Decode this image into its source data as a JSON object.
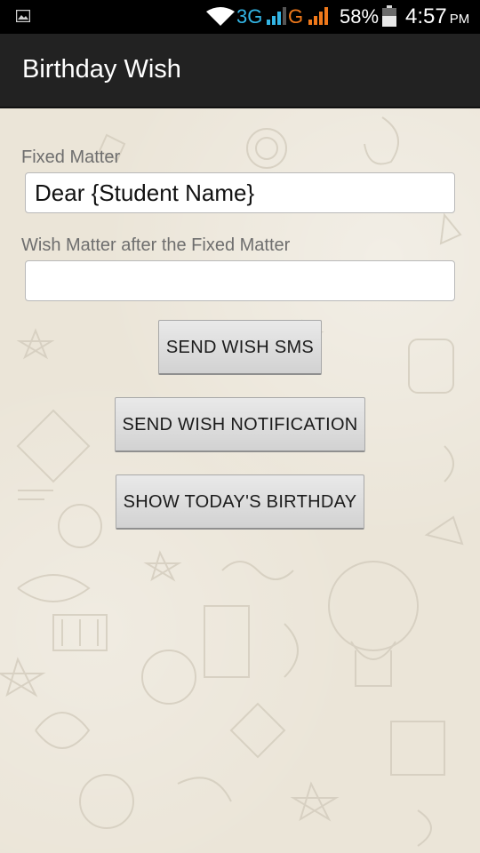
{
  "status_bar": {
    "network_3g": "3G",
    "network_g": "G",
    "battery_percent": "58%",
    "time": "4:57",
    "ampm": "PM"
  },
  "action_bar": {
    "title": "Birthday Wish"
  },
  "form": {
    "fixed_matter_label": "Fixed Matter",
    "fixed_matter_value": "Dear {Student Name}",
    "wish_matter_label": "Wish Matter after the Fixed Matter",
    "wish_matter_value": ""
  },
  "buttons": {
    "send_sms": "SEND WISH SMS",
    "send_notification": "SEND WISH NOTIFICATION",
    "show_birthday": "SHOW TODAY'S BIRTHDAY"
  },
  "colors": {
    "action_bar_bg": "#222222",
    "network_3g": "#33b5e5",
    "network_g": "#f0791b",
    "background": "#ebe5d8"
  }
}
